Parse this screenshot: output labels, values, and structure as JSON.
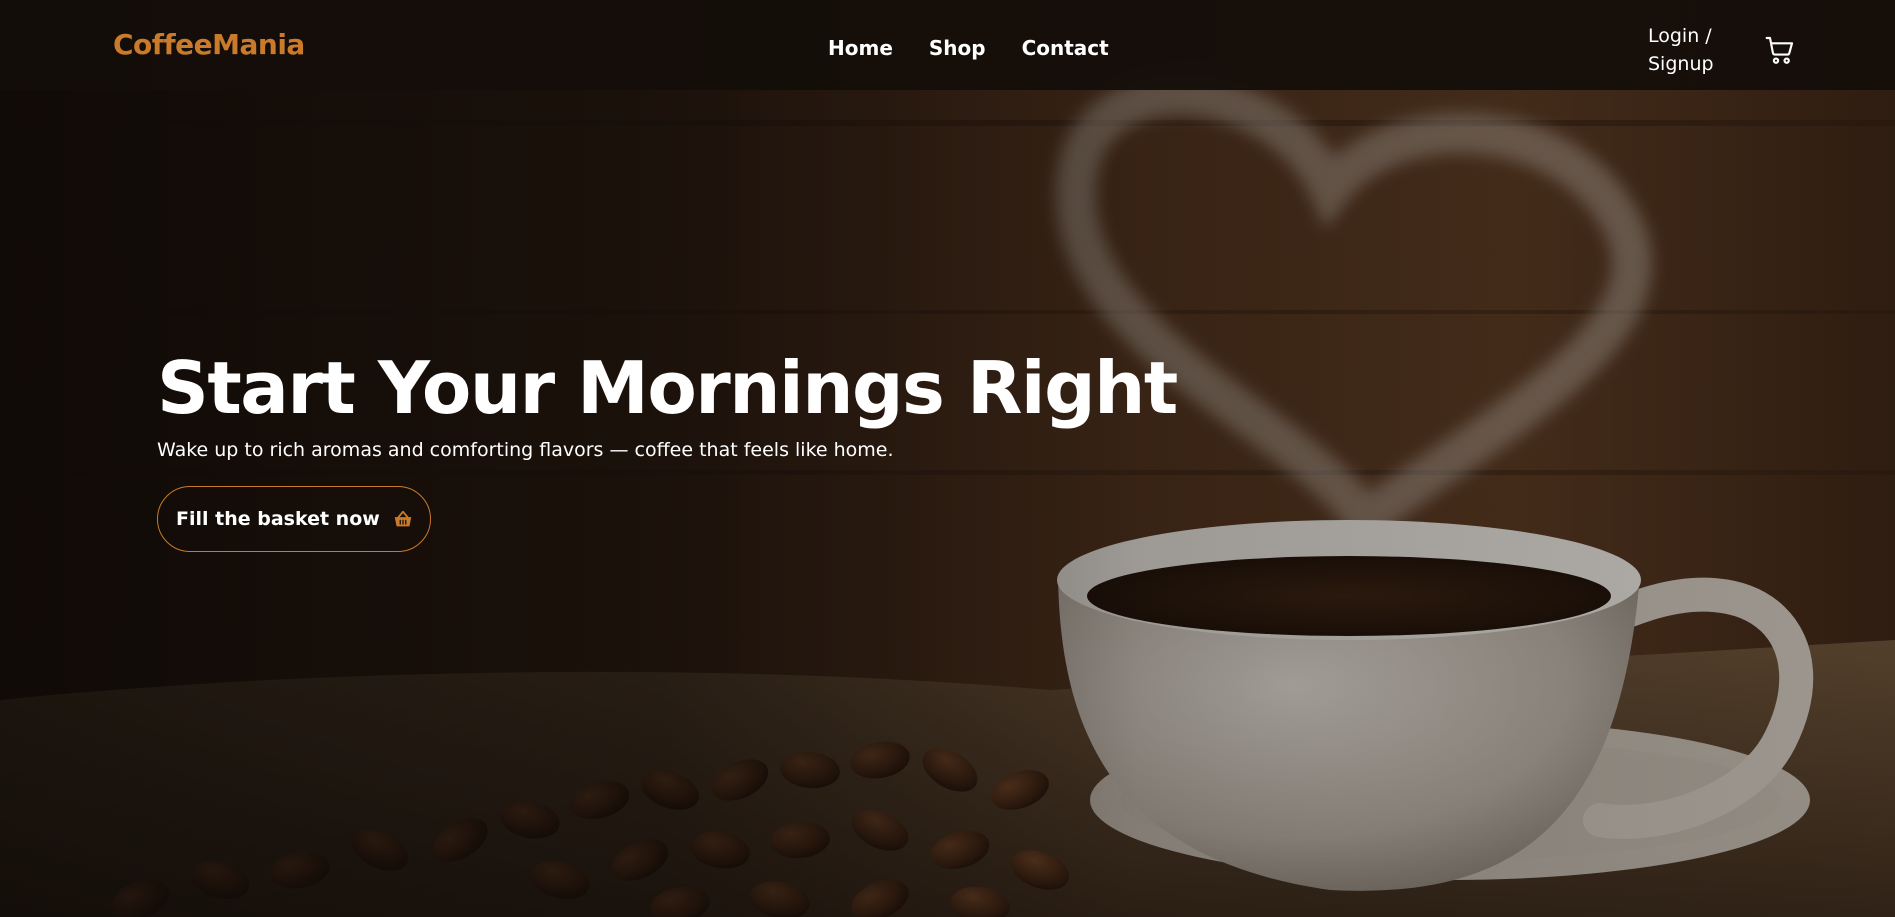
{
  "brand": {
    "name": "CoffeeMania"
  },
  "nav": {
    "links": [
      {
        "label": "Home"
      },
      {
        "label": "Shop"
      },
      {
        "label": "Contact"
      }
    ],
    "auth_label_line1": "Login /",
    "auth_label_line2": "Signup",
    "cart_icon": "cart-icon"
  },
  "hero": {
    "title": "Start Your Mornings Right",
    "subtitle": "Wake up to rich aromas and comforting flavors — coffee that feels like home.",
    "cta_label": "Fill the basket now",
    "cta_icon": "basket-icon"
  },
  "colors": {
    "accent": "#c97a2b",
    "navbar_bg": "#140e0a",
    "text": "#ffffff"
  }
}
